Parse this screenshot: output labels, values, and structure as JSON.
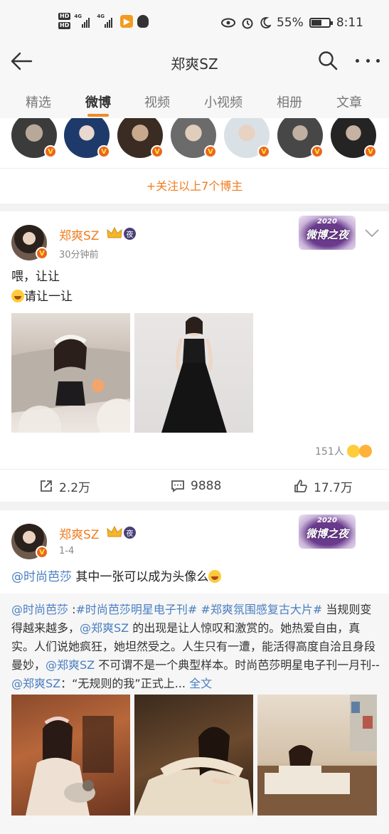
{
  "status_bar": {
    "hd_top": "HD",
    "hd_bottom": "HD",
    "net1": "4G",
    "net2": "4G",
    "battery_percent": "55%",
    "battery_level": 0.55,
    "time": "8:11",
    "icons": [
      "eye-icon",
      "alarm-icon",
      "moon-icon"
    ]
  },
  "header": {
    "title": "郑爽SZ",
    "back_icon": "arrow-left-icon",
    "search_icon": "search-icon",
    "more_icon": "more-dots-icon"
  },
  "tabs": [
    {
      "label": "精选",
      "active": false
    },
    {
      "label": "微博",
      "active": true
    },
    {
      "label": "视频",
      "active": false
    },
    {
      "label": "小视频",
      "active": false
    },
    {
      "label": "相册",
      "active": false
    },
    {
      "label": "文章",
      "active": false
    }
  ],
  "follow_bar": {
    "label": "+关注以上7个博主"
  },
  "posts": [
    {
      "author": "郑爽SZ",
      "time": "30分钟前",
      "badge": "夜",
      "event_badge": {
        "year": "2020",
        "text": "微博之夜"
      },
      "text_line1": "喂，让让",
      "text_line2": "请让一让",
      "reactions_count": "151人",
      "repost_count": "2.2万",
      "comment_count": "9888",
      "like_count": "17.7万"
    },
    {
      "author": "郑爽SZ",
      "time": "1-4",
      "badge": "夜",
      "event_badge": {
        "year": "2020",
        "text": "微博之夜"
      },
      "mention": "@时尚芭莎",
      "text": " 其中一张可以成为头像么",
      "retweet": {
        "author": "@时尚芭莎",
        "tag1": "#时尚芭莎明星电子刊#",
        "tag2": "#郑爽氛围感复古大片#",
        "seg1": " 当规则变得越来越多，",
        "mention2": "@郑爽SZ",
        "seg2": " 的出现是让人惊叹和激赏的。她热爱自由，真实。人们说她疯狂，她坦然受之。人生只有一遭，能活得高度自洽且身段曼妙，",
        "mention3": "@郑爽SZ",
        "seg3": " 不可谓不是一个典型样本。时尚芭莎明星电子刊一月刊--",
        "mention4": "@郑爽SZ",
        "seg4": "：“无规则的我”正式上...",
        "full_text_link": "全文"
      }
    }
  ]
}
